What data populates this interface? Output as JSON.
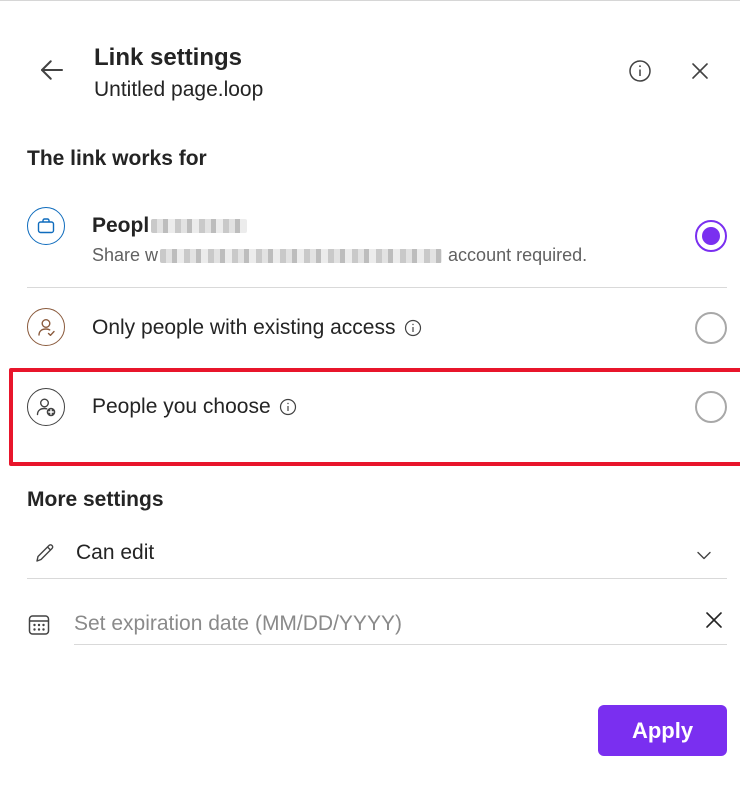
{
  "header": {
    "title": "Link settings",
    "subtitle": "Untitled page.loop"
  },
  "link_section": {
    "heading": "The link works for",
    "options": [
      {
        "icon": "briefcase-icon",
        "title": "Peopl",
        "description_start": "Share w",
        "description_end": "account required.",
        "selected": true
      },
      {
        "icon": "person-check-icon",
        "title": "Only people with existing access",
        "selected": false
      },
      {
        "icon": "person-add-icon",
        "title": "People you choose",
        "selected": false
      }
    ]
  },
  "more_settings": {
    "heading": "More settings",
    "permission": "Can edit",
    "expiration_placeholder": "Set expiration date (MM/DD/YYYY)"
  },
  "footer": {
    "apply_label": "Apply"
  },
  "colors": {
    "accent": "#7a2ff0",
    "highlight": "#e8152b",
    "org_icon": "#0f6cbd",
    "person_icon": "#8a5a3c"
  }
}
